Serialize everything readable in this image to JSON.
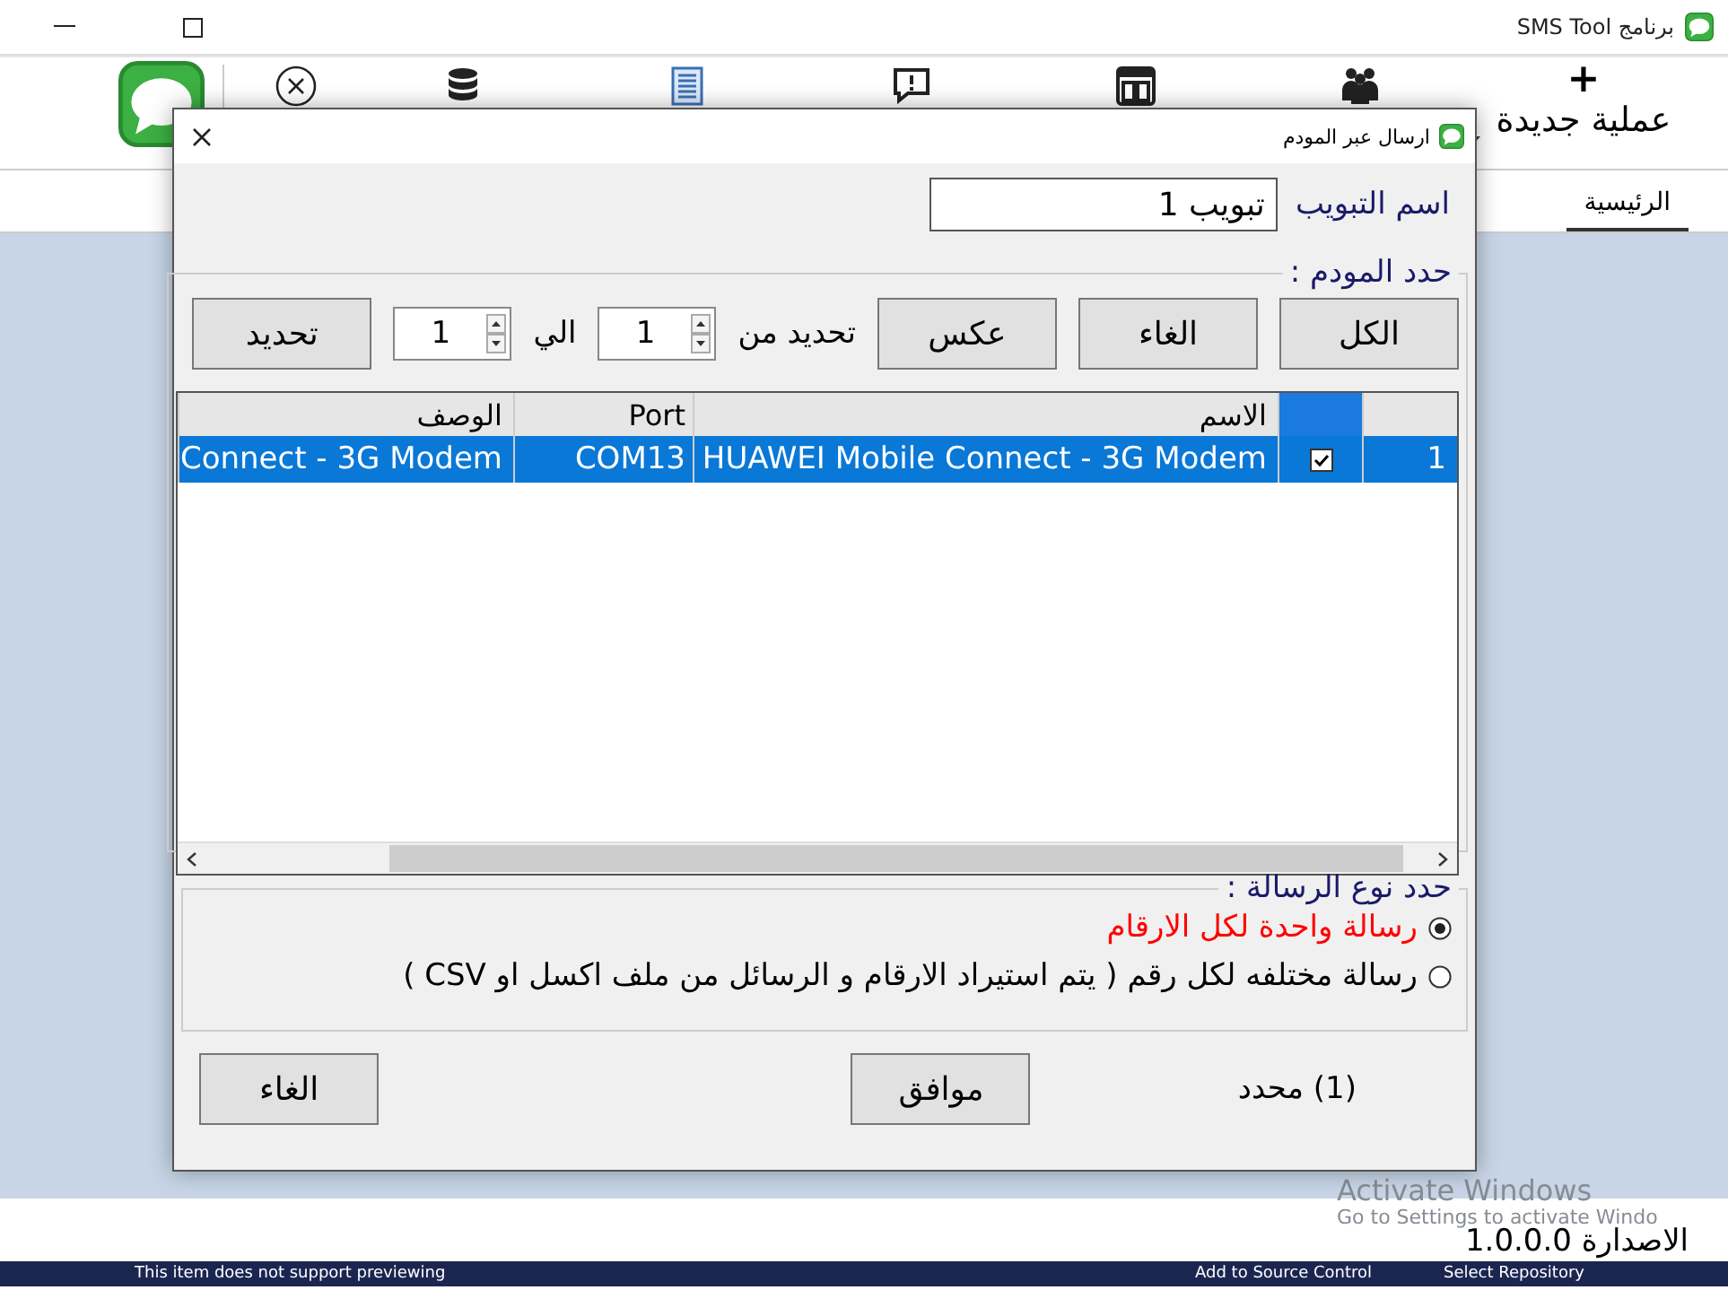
{
  "window": {
    "title": "برنامج SMS Tool"
  },
  "toolbar": {
    "new_icon": "+",
    "new_label": "عملية جديدة"
  },
  "tabs": [
    {
      "label": "الرئيسية",
      "selected": true
    }
  ],
  "dialog": {
    "title": "ارسال عبر المودم",
    "tab_name": {
      "label": "اسم التبويب",
      "value": "تبويب 1"
    },
    "modem_group": {
      "title": "حدد المودم :",
      "buttons": [
        "الكل",
        "الغاء",
        "عكس"
      ],
      "from_label": "تحديد من",
      "from_value": "1",
      "to_label": "الي",
      "to_value": "1",
      "apply_button": "تحديد"
    },
    "table": {
      "columns": [
        "الاسم",
        "Port",
        "الوصف"
      ],
      "rows": [
        {
          "index": "1",
          "checked": true,
          "name": "HUAWEI Mobile Connect - 3G Modem",
          "port": "COM13",
          "description": "Connect - 3G Modem",
          "selected": true
        }
      ]
    },
    "message_group": {
      "title": "حدد نوع الرسالة :",
      "options": [
        {
          "label": "رسالة واحدة  لكل الارقام",
          "selected": true,
          "color": "#ff0000"
        },
        {
          "label": "رسالة مختلفه لكل رقم ( يتم استيراد الارقام و الرسائل من ملف اكسل او CSV )",
          "selected": false,
          "color": "#000000"
        }
      ]
    },
    "footer": {
      "cancel_button": "الغاء",
      "ok_button": "موافق",
      "count": "(1) محدد"
    }
  },
  "status_bar": {
    "version": "الاصدارة 1.0.0.0"
  },
  "activation": {
    "title": "Activate Windows",
    "text": "Go to Settings to activate Windo"
  },
  "taskbar": {
    "items": [
      "Select Repository",
      "Add to Source Control",
      "This item does not support previewing"
    ]
  }
}
